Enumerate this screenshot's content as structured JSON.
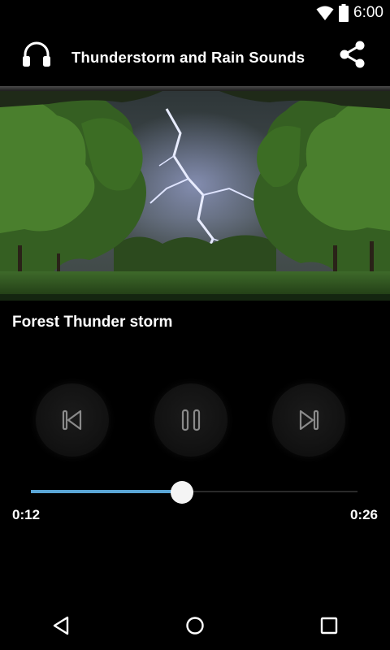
{
  "status_bar": {
    "time": "6:00",
    "icons": [
      "wifi-icon",
      "battery-icon"
    ]
  },
  "app_bar": {
    "title": "Thunderstorm and Rain Sounds",
    "left_icon": "headphones-icon",
    "right_icon": "share-icon"
  },
  "artwork": {
    "subject": "storm-forest-lightning"
  },
  "track": {
    "title": "Forest Thunder storm"
  },
  "controls": {
    "prev_icon": "skip-previous-icon",
    "play_pause_icon": "pause-icon",
    "next_icon": "skip-next-icon"
  },
  "progress": {
    "elapsed": "0:12",
    "total": "0:26",
    "fraction": 0.4615,
    "accent": "#5aa6d6"
  },
  "nav_bar": {
    "icons": [
      "back-icon",
      "home-icon",
      "recents-icon"
    ]
  }
}
